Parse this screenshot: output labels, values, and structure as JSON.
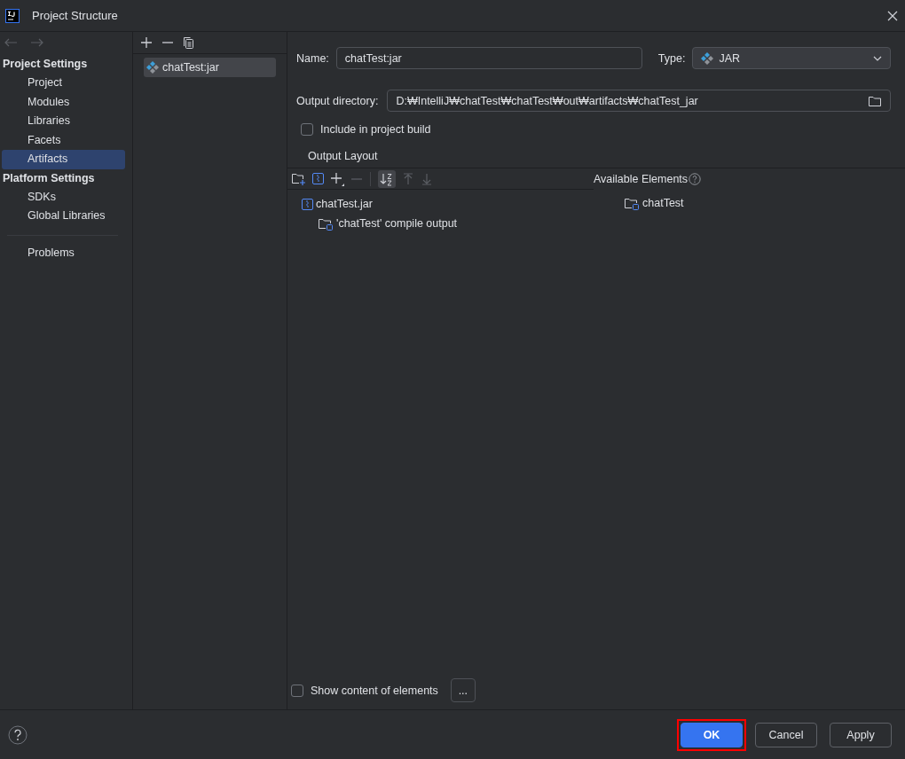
{
  "window": {
    "title": "Project Structure"
  },
  "sidebar": {
    "sections": [
      {
        "heading": "Project Settings",
        "items": [
          {
            "label": "Project",
            "selected": false
          },
          {
            "label": "Modules",
            "selected": false
          },
          {
            "label": "Libraries",
            "selected": false
          },
          {
            "label": "Facets",
            "selected": false
          },
          {
            "label": "Artifacts",
            "selected": true
          }
        ]
      },
      {
        "heading": "Platform Settings",
        "items": [
          {
            "label": "SDKs",
            "selected": false
          },
          {
            "label": "Global Libraries",
            "selected": false
          }
        ]
      }
    ],
    "footer_items": [
      {
        "label": "Problems",
        "selected": false
      }
    ]
  },
  "artifacts": [
    {
      "label": "chatTest:jar",
      "selected": true
    }
  ],
  "editor": {
    "name_label": "Name:",
    "name_value": "chatTest:jar",
    "type_label": "Type:",
    "type_value": "JAR",
    "output_dir_label": "Output directory:",
    "output_dir_value": "D:₩IntelliJ₩chatTest₩chatTest₩out₩artifacts₩chatTest_jar",
    "include_in_build": {
      "label": "Include in project build",
      "checked": false
    },
    "output_layout_label": "Output Layout",
    "sort_on": true,
    "available_label": "Available Elements",
    "layout_tree": [
      {
        "label": "chatTest.jar",
        "kind": "jar",
        "children": [
          {
            "label": "'chatTest' compile output",
            "kind": "output"
          }
        ]
      }
    ],
    "available_tree": [
      {
        "label": "chatTest",
        "kind": "module"
      }
    ],
    "show_content": {
      "label": "Show content of elements",
      "checked": false
    },
    "more_button": "..."
  },
  "buttons": [
    {
      "label": "OK",
      "kind": "primary",
      "highlighted": true
    },
    {
      "label": "Cancel",
      "kind": "secondary",
      "highlighted": false
    },
    {
      "label": "Apply",
      "kind": "secondary",
      "highlighted": false
    }
  ]
}
